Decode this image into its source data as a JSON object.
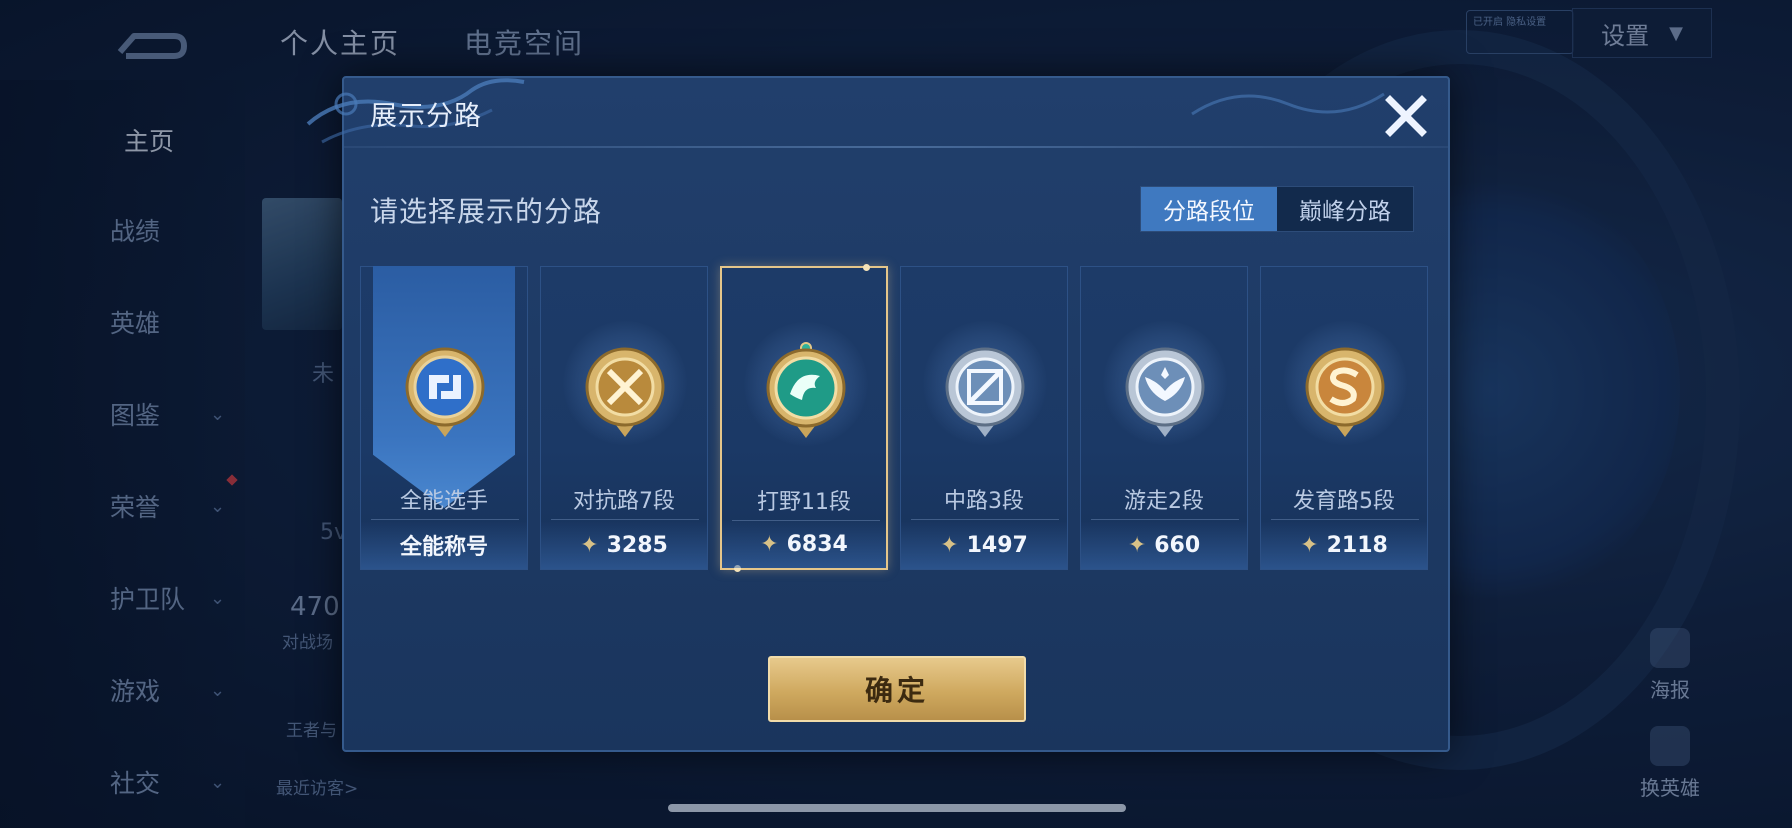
{
  "background": {
    "tabs": [
      "个人主页",
      "电竞空间"
    ],
    "settings_label": "设置",
    "top_badge_text": "已开启 隐私设置",
    "sidebar": [
      {
        "label": "主页",
        "has_chevron": false,
        "active": true
      },
      {
        "label": "战绩",
        "has_chevron": false,
        "active": false
      },
      {
        "label": "英雄",
        "has_chevron": false,
        "active": false
      },
      {
        "label": "图鉴",
        "has_chevron": true,
        "active": false
      },
      {
        "label": "荣誉",
        "has_chevron": true,
        "active": false
      },
      {
        "label": "护卫队",
        "has_chevron": true,
        "active": false
      },
      {
        "label": "游戏",
        "has_chevron": true,
        "active": false
      },
      {
        "label": "社交",
        "has_chevron": true,
        "active": false
      }
    ],
    "fragments": {
      "unplayed": "未",
      "five_v": "5v",
      "count": "470",
      "matches": "对战场",
      "king": "王者与",
      "recent_visitors": "最近访客>"
    },
    "poster_label": "海报",
    "swap_hero_label": "换英雄"
  },
  "modal": {
    "title": "展示分路",
    "subtitle": "请选择展示的分路",
    "segment": {
      "options": [
        "分路段位",
        "巅峰分路"
      ],
      "selected": "分路段位"
    },
    "cards": [
      {
        "name": "全能选手",
        "value": "全能称号",
        "emblem": "all-round-emblem-icon",
        "selected": false,
        "ribbon": true
      },
      {
        "name": "对抗路7段",
        "value": "3285",
        "emblem": "clash-lane-emblem-icon",
        "selected": false,
        "ribbon": false
      },
      {
        "name": "打野11段",
        "value": "6834",
        "emblem": "jungle-dragon-emblem-icon",
        "selected": true,
        "ribbon": false
      },
      {
        "name": "中路3段",
        "value": "1497",
        "emblem": "mid-lane-emblem-icon",
        "selected": false,
        "ribbon": false
      },
      {
        "name": "游走2段",
        "value": "660",
        "emblem": "roam-wings-emblem-icon",
        "selected": false,
        "ribbon": false
      },
      {
        "name": "发育路5段",
        "value": "2118",
        "emblem": "farm-lane-emblem-icon",
        "selected": false,
        "ribbon": false
      }
    ],
    "confirm_label": "确定"
  },
  "colors": {
    "accent_gold": "#e5c68a",
    "segment_active": "#3f79c0",
    "modal_bg": "#1f3c69"
  }
}
